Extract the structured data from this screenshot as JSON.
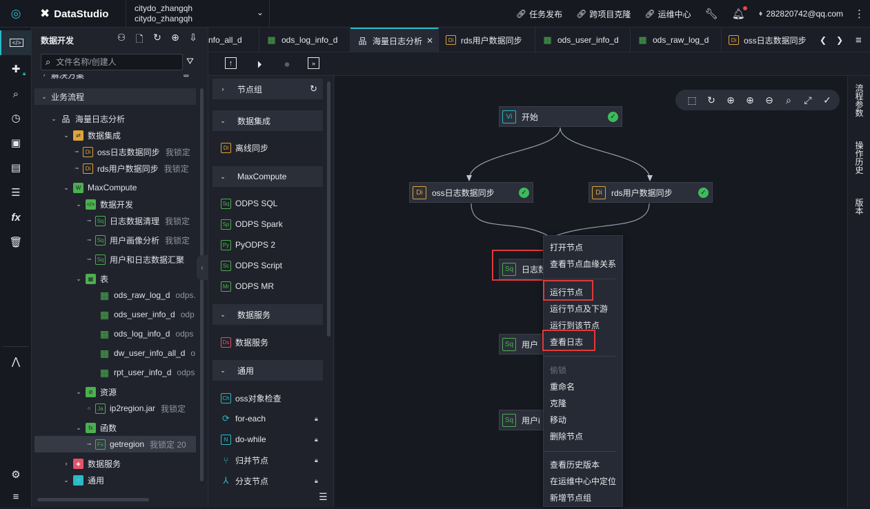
{
  "header": {
    "brand": "DataStudio",
    "project_line1": "citydo_zhangqh",
    "project_line2": "citydo_zhangqh",
    "links": [
      "任务发布",
      "跨项目克隆",
      "运维中心"
    ],
    "user": "282820742@qq.com"
  },
  "panel": {
    "title": "数据开发",
    "search_placeholder": "文件名称/创建人"
  },
  "tree": {
    "partial_top": "解决方案",
    "section": "业务流程",
    "workflow": "海量日志分析",
    "integration": "数据集成",
    "oss_sync": "oss日志数据同步",
    "oss_sync_meta": "我锁定",
    "rds_sync": "rds用户数据同步",
    "rds_sync_meta": "我锁定",
    "maxcompute": "MaxCompute",
    "dev": "数据开发",
    "sql1": "日志数据清理",
    "sql1_meta": "我锁定",
    "sql2": "用户画像分析",
    "sql2_meta": "我锁定",
    "sql3": "用户和日志数据汇聚",
    "tables": "表",
    "t1": "ods_raw_log_d",
    "t1_meta": "odps.",
    "t2": "ods_user_info_d",
    "t2_meta": "odp",
    "t3": "ods_log_info_d",
    "t3_meta": "odps",
    "t4": "dw_user_info_all_d",
    "t4_meta": "o",
    "t5": "rpt_user_info_d",
    "t5_meta": "odps",
    "resources": "资源",
    "jar": "ip2region.jar",
    "jar_meta": "我锁定",
    "functions": "函数",
    "fn": "getregion",
    "fn_meta": "我锁定  20",
    "data_service": "数据服务",
    "general": "通用"
  },
  "tabs": [
    "nfo_all_d",
    "ods_log_info_d",
    "海量日志分析",
    "rds用户数据同步",
    "ods_user_info_d",
    "ods_raw_log_d",
    "oss日志数据同步"
  ],
  "palette": {
    "g_nodegroup": "节点组",
    "g_integration": "数据集成",
    "offline_sync": "离线同步",
    "g_maxcompute": "MaxCompute",
    "odps_sql": "ODPS SQL",
    "odps_spark": "ODPS Spark",
    "pyodps": "PyODPS 2",
    "odps_script": "ODPS Script",
    "odps_mr": "ODPS MR",
    "g_dataservice": "数据服务",
    "dataservice": "数据服务",
    "g_general": "通用",
    "oss_check": "oss对象检查",
    "foreach": "for-each",
    "dowhile": "do-while",
    "merge": "归并节点",
    "branch": "分支节点"
  },
  "canvas": {
    "start": "开始",
    "oss_node": "oss日志数据同步",
    "rds_node": "rds用户数据同步",
    "clean_node": "日志数",
    "profile_node": "用户",
    "merge_node": "用户i"
  },
  "context_menu": {
    "open": "打开节点",
    "lineage": "查看节点血缘关系",
    "run": "运行节点",
    "run_down": "运行节点及下游",
    "run_to": "运行到该节点",
    "view_log": "查看日志",
    "lock": "偷锁",
    "rename": "重命名",
    "clone": "克隆",
    "move": "移动",
    "delete": "删除节点",
    "history": "查看历史版本",
    "locate": "在运维中心中定位",
    "new_group": "新增节点组"
  },
  "right_panel": [
    "流程参数",
    "操作历史",
    "版本"
  ]
}
